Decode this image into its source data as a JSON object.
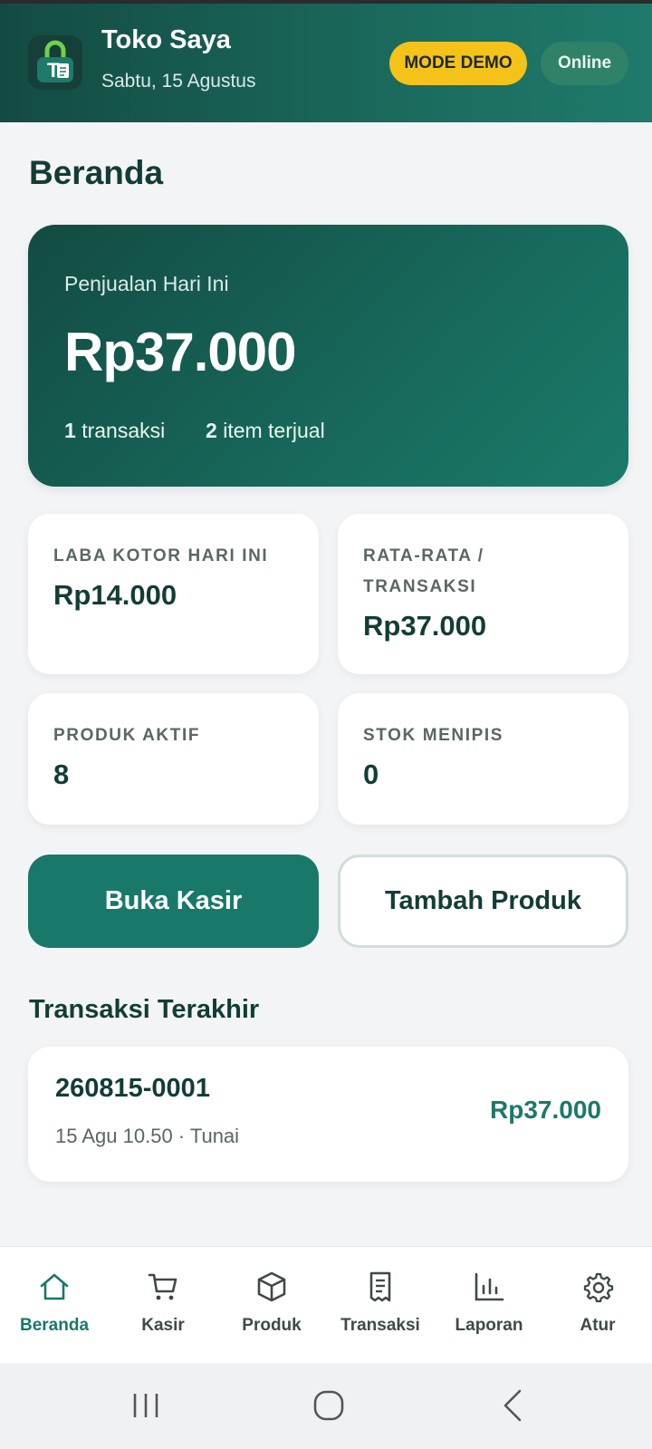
{
  "header": {
    "store_name": "Toko Saya",
    "date": "Sabtu, 15 Agustus",
    "demo_badge": "MODE DEMO",
    "online_badge": "Online",
    "logo_text": "T"
  },
  "page": {
    "title": "Beranda"
  },
  "hero": {
    "label": "Penjualan Hari Ini",
    "amount": "Rp37.000",
    "tx_count": "1",
    "tx_label": "transaksi",
    "items_count": "2",
    "items_label": "item terjual"
  },
  "stats": [
    {
      "label": "LABA KOTOR HARI INI",
      "value": "Rp14.000"
    },
    {
      "label": "RATA-RATA / TRANSAKSI",
      "value": "Rp37.000"
    },
    {
      "label": "PRODUK AKTIF",
      "value": "8"
    },
    {
      "label": "STOK MENIPIS",
      "value": "0"
    }
  ],
  "actions": {
    "primary": "Buka Kasir",
    "secondary": "Tambah Produk"
  },
  "recent": {
    "title": "Transaksi Terakhir",
    "items": [
      {
        "id": "260815-0001",
        "meta": "15 Agu 10.50 · Tunai",
        "amount": "Rp37.000"
      }
    ]
  },
  "nav": [
    {
      "label": "Beranda",
      "icon": "home-icon",
      "active": true
    },
    {
      "label": "Kasir",
      "icon": "cart-icon"
    },
    {
      "label": "Produk",
      "icon": "box-icon"
    },
    {
      "label": "Transaksi",
      "icon": "receipt-icon"
    },
    {
      "label": "Laporan",
      "icon": "bar-chart-icon"
    },
    {
      "label": "Atur",
      "icon": "gear-icon"
    }
  ],
  "colors": {
    "brand_dark": "#134b42",
    "brand": "#18796a",
    "demo_yellow": "#f5c21a",
    "online_green": "#2f8268"
  }
}
